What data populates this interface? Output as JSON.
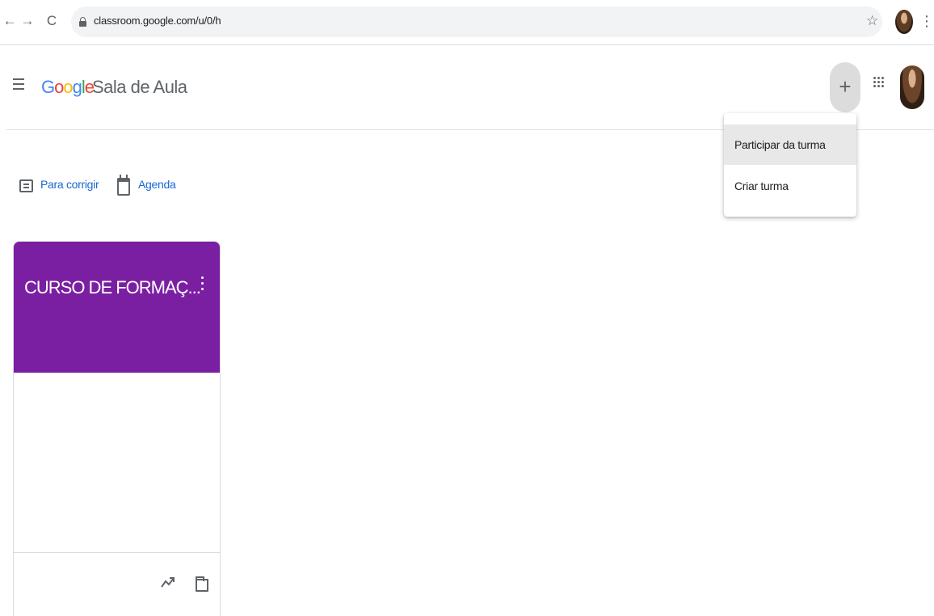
{
  "browser": {
    "back_glyph": "←",
    "forward_glyph": "→",
    "reload_glyph": "C",
    "url": "classroom.google.com/u/0/h",
    "star_glyph": "☆",
    "menu_glyph": "⋮"
  },
  "app": {
    "logo_letters": [
      {
        "char": "G",
        "color": "#4285F4"
      },
      {
        "char": "o",
        "color": "#EA4335"
      },
      {
        "char": "o",
        "color": "#FBBC05"
      },
      {
        "char": "g",
        "color": "#4285F4"
      },
      {
        "char": "l",
        "color": "#34A853"
      },
      {
        "char": "e",
        "color": "#EA4335"
      }
    ],
    "product_name": "Sala de Aula",
    "add_glyph": "+"
  },
  "menu": {
    "items": [
      {
        "label": "Participar da turma",
        "hovered": true
      },
      {
        "label": "Criar turma",
        "hovered": false
      }
    ]
  },
  "quick_links": {
    "todo_label": "Para corrigir",
    "calendar_label": "Agenda"
  },
  "classes": [
    {
      "title": "CURSO DE FORMAÇ...",
      "header_color": "#7b1fa2"
    }
  ],
  "colors": {
    "link": "#1967d2",
    "icon": "#5f6368",
    "accent_purple": "#7b1fa2"
  }
}
